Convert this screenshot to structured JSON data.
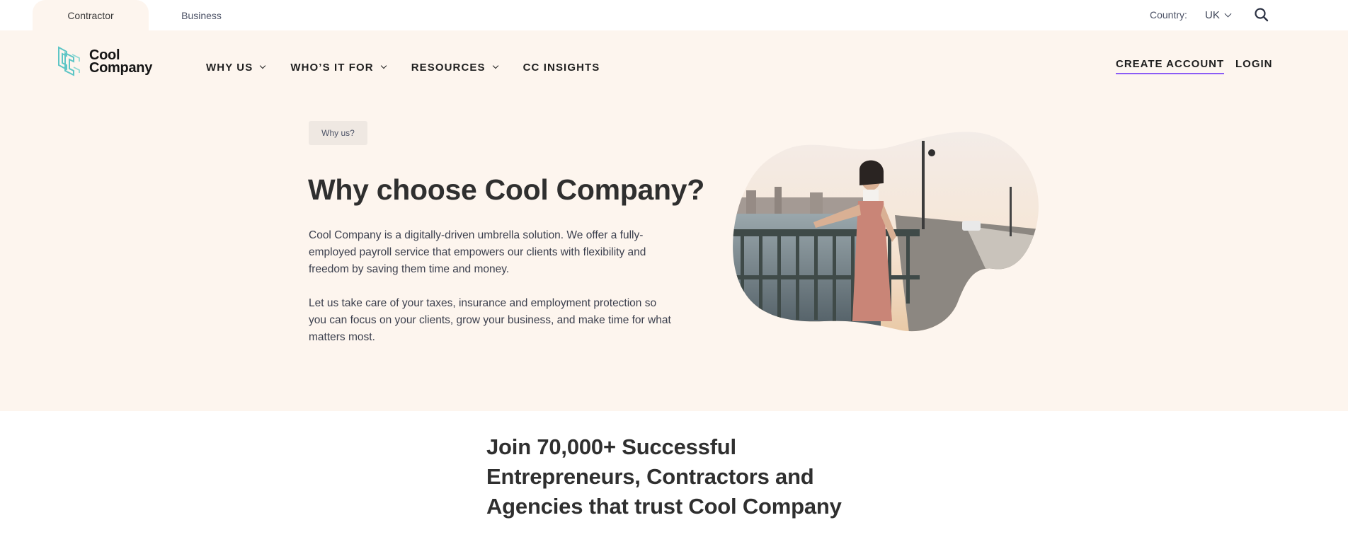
{
  "topbar": {
    "tabs": [
      {
        "label": "Contractor",
        "active": true
      },
      {
        "label": "Business",
        "active": false
      }
    ],
    "country_label": "Country:",
    "country_value": "UK",
    "search_icon": "search-icon"
  },
  "header": {
    "logo": {
      "line1": "Cool",
      "line2": "Company"
    },
    "nav": [
      {
        "label": "WHY US",
        "has_dropdown": true
      },
      {
        "label": "WHO’S IT FOR",
        "has_dropdown": true
      },
      {
        "label": "RESOURCES",
        "has_dropdown": true
      },
      {
        "label": "CC INSIGHTS",
        "has_dropdown": false
      }
    ],
    "create_account": "CREATE ACCOUNT",
    "login": "LOGIN"
  },
  "hero": {
    "eyebrow": "Why us?",
    "title": "Why choose Cool Company?",
    "paragraph1": "Cool Company is a digitally-driven umbrella solution. We offer a fully-employed payroll service that empowers our clients with flexibility and freedom by saving them time and money.",
    "paragraph2": "Let us take care of your taxes, insurance and employment protection so you can focus on your clients, grow your business, and make time for what matters most."
  },
  "stats": {
    "title": "Join 70,000+ Successful Entrepreneurs, Contractors and Agencies that trust Cool Company"
  },
  "colors": {
    "hero_bg": "#fdf5ee",
    "accent_underline": "#8b5cf6",
    "logo_teal": "#5ec6c6",
    "text_dark": "#2f2f2f"
  }
}
